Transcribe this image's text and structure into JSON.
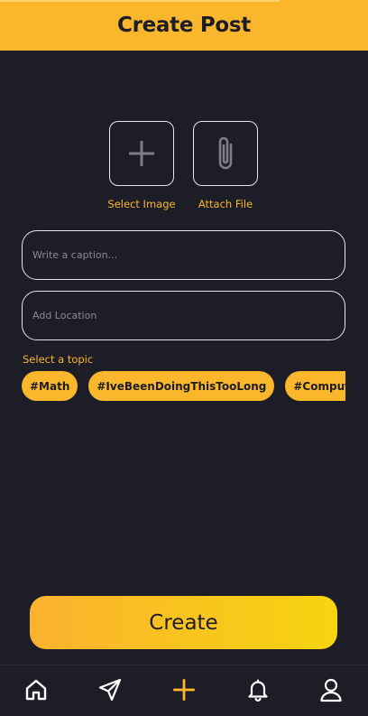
{
  "header": {
    "title": "Create Post"
  },
  "attachments": {
    "select_image_label": "Select Image",
    "attach_file_label": "Attach File"
  },
  "caption": {
    "placeholder": "Write a caption..."
  },
  "location": {
    "placeholder": "Add Location"
  },
  "topics": {
    "label": "Select a topic",
    "items": [
      "#Math",
      "#IveBeenDoingThisTooLong",
      "#ComputerScience"
    ]
  },
  "create_button": {
    "label": "Create"
  },
  "nav": {
    "items": [
      "home-icon",
      "send-icon",
      "plus-icon",
      "bell-icon",
      "profile-icon"
    ],
    "active_index": 2
  },
  "colors": {
    "accent": "#fbb72c",
    "background": "#1c1d27",
    "gradient_end": "#f7d40f",
    "border": "#e6e6e6",
    "placeholder": "#8a8b92"
  }
}
